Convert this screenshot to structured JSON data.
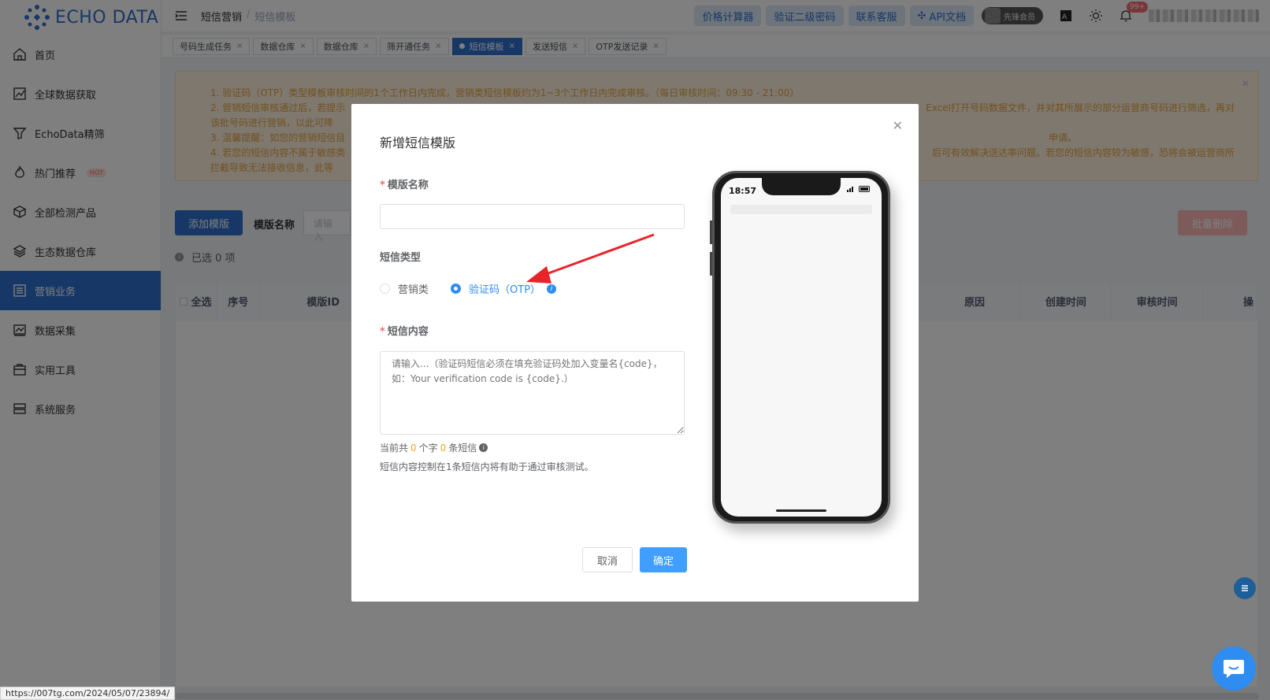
{
  "app": {
    "logo_text": "ECHO DATA",
    "brand_color": "#2f6fce"
  },
  "sidebar": {
    "items": [
      {
        "label": "首页",
        "icon": "home-icon"
      },
      {
        "label": "全球数据获取",
        "icon": "chart-icon"
      },
      {
        "label": "EchoData精筛",
        "icon": "filter-icon"
      },
      {
        "label": "热门推荐",
        "icon": "fire-icon",
        "badge": "HOT"
      },
      {
        "label": "全部检测产品",
        "icon": "cube-icon"
      },
      {
        "label": "生态数据仓库",
        "icon": "layers-icon"
      },
      {
        "label": "营销业务",
        "icon": "list-icon",
        "active": true
      },
      {
        "label": "数据采集",
        "icon": "graph-icon"
      },
      {
        "label": "实用工具",
        "icon": "briefcase-icon"
      },
      {
        "label": "系统服务",
        "icon": "server-icon"
      }
    ]
  },
  "header": {
    "breadcrumb": [
      "短信营销",
      "短信模板"
    ],
    "buttons": [
      "价格计算器",
      "验证二级密码",
      "联系客服",
      "API文档"
    ],
    "vip_label": "先锋会员",
    "notification_count": "99+"
  },
  "tabs": [
    {
      "label": "号码生成任务"
    },
    {
      "label": "数据仓库"
    },
    {
      "label": "数据仓库"
    },
    {
      "label": "筛开通任务"
    },
    {
      "label": "短信模板",
      "active": true
    },
    {
      "label": "发送短信"
    },
    {
      "label": "OTP发送记录"
    }
  ],
  "notice": {
    "lines": [
      "1. 验证码（OTP）类型模板审核时间的1个工作日内完成，营销类短信模板约为1~3个工作日内完成审核。（每日审核时间：09:30 - 21:00）",
      "2. 营销短信审核通过后，若提示",
      "    该批号码进行营销，以此可降",
      "3. 温馨提醒：如您的营销短信目",
      "4. 若您的短信内容不属于敏感类",
      "    拦截导致无法接收信息，此等"
    ],
    "right_fragments": [
      "Excel打开号码数据文件，并对其所展示的部分运营商号码进行筛选，再对",
      "申请。",
      "后可有效解决送达率问题。若您的短信内容较为敏感，恐将会被运营商所"
    ]
  },
  "toolbar": {
    "add_label": "添加模版",
    "name_label": "模版名称",
    "name_placeholder": "请输入",
    "batch_delete_label": "批量删除",
    "selected_text": "已选 0 项"
  },
  "table": {
    "columns": [
      "全选",
      "序号",
      "模版ID",
      "原因",
      "创建时间",
      "审核时间",
      "操"
    ]
  },
  "modal": {
    "title": "新增短信模版",
    "name_label": "模版名称",
    "type_label": "短信类型",
    "type_options": [
      "营销类",
      "验证码（OTP）"
    ],
    "selected_type": "验证码（OTP）",
    "content_label": "短信内容",
    "content_placeholder": "请输入...（验证码短信必须在填充验证码处加入变量名{code}，如：Your verification code is {code}.）",
    "count_prefix": "当前共",
    "char_count": "0",
    "count_mid": "个字",
    "sms_count": "0",
    "count_suffix": "条短信",
    "hint": "短信内容控制在1条短信内将有助于通过审核测试。",
    "cancel_label": "取消",
    "ok_label": "确定"
  },
  "phone": {
    "time": "18:57"
  },
  "status_url": "https://007tg.com/2024/05/07/23894/"
}
